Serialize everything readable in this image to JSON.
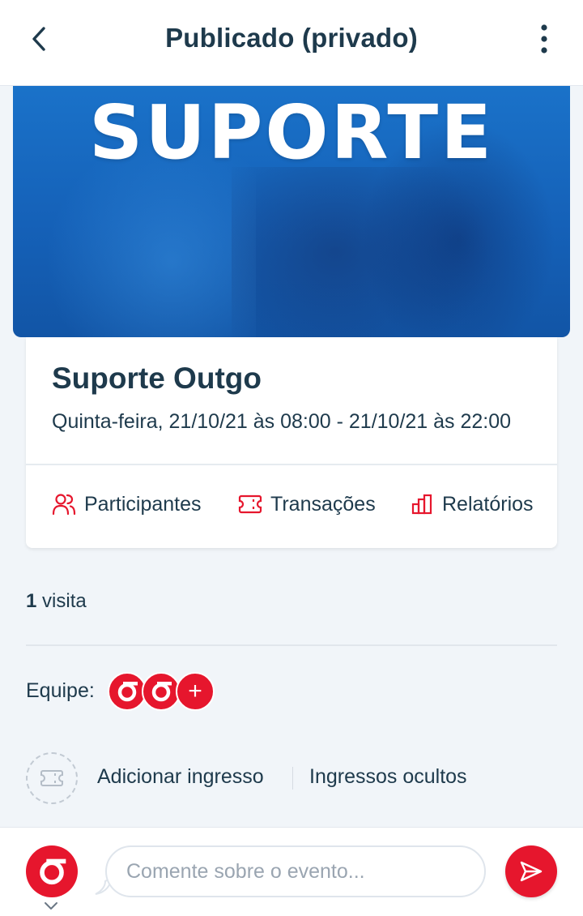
{
  "header": {
    "title": "Publicado (privado)",
    "back_icon": "chevron-left-icon",
    "menu_icon": "more-vertical-icon"
  },
  "banner": {
    "text": "SUPORTE"
  },
  "event": {
    "title": "Suporte Outgo",
    "date": "Quinta-feira, 21/10/21 às 08:00 - 21/10/21 às 22:00"
  },
  "actions": [
    {
      "label": "Participantes",
      "icon": "users-icon"
    },
    {
      "label": "Transações",
      "icon": "ticket-icon"
    },
    {
      "label": "Relatórios",
      "icon": "bar-chart-icon"
    }
  ],
  "visits": {
    "count": "1",
    "label": "visita"
  },
  "team": {
    "label": "Equipe:",
    "add_symbol": "+"
  },
  "tickets": {
    "add_label": "Adicionar ingresso",
    "hidden_label": "Ingressos ocultos"
  },
  "comment": {
    "placeholder": "Comente sobre o evento..."
  },
  "colors": {
    "accent": "#e6162d",
    "text": "#1e3a4c",
    "banner": "#1561b8",
    "background": "#f1f5f9"
  }
}
